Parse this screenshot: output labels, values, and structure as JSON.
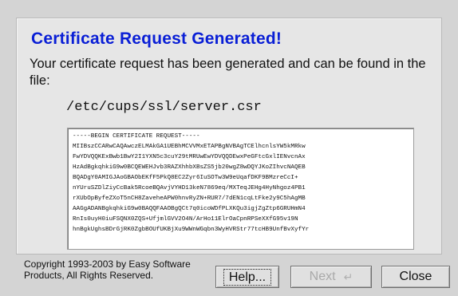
{
  "dialog": {
    "title": "Certificate Request Generated!",
    "message": "Your certificate request has been generated and can be found in the file:",
    "file_path": "/etc/cups/ssl/server.csr",
    "csr_text": "-----BEGIN CERTIFICATE REQUEST-----\nMIIBszCCARwCAQAwczELMAkGA1UEBhMCVVMxETAPBgNVBAgTCElhcnlsYW5kMRkw\nFwYDVQQKExBwb1BwY2I1YXN5c3cuY29tMRUwEwYDVQQDEwxPeGFtcGxlIENvcnAx\nHzAdBgkqhkiG9w0BCQEWEHJvb3RAZXhhbXBsZS5jb20wgZ8wDQYJKoZIhvcNAQEB\nBQADgY0AMIGJAoGBAObEKfF5PkQ8EC2Zyr6IuSOTw3W9eUqafDKF9BMzreCcI+\nnYUruSZDlZiyCcBak5RcoeBQAvjVYHD13keN7869eq/MXTeqJEHg4HyNhgoz4PB1\nrXUbOpByfeZXoT5nCH8ZaveheAPW0hnvRyZN+RUR7/7dEN1cqLtFke2y9C5hAgMB\nAAGgADANBgkqhkiG9w0BAQQFAAOBgQCt7q0icoWDfPLXKQu3igjZgZtp6GRUHmN4\nRnIs0uyH0iuFSQNX0ZQS+UfjmlGVV2O4N/ArHo11ElrOaCpnRPSeXXfG95v19N\nhnBgkUghsBDrGjRK0ZgbBOUfUKBjXu9WWnWGqbn3WyHVRStr77tcHB9UnfBvXyfYr"
  },
  "footer": {
    "copyright": "Copyright 1993-2003 by Easy Software Products, All Rights Reserved."
  },
  "buttons": {
    "help_label": "Help...",
    "next_label": "Next",
    "next_enabled": false,
    "close_label": "Close"
  },
  "icons": {
    "next_arrow": "return-arrow-icon"
  },
  "colors": {
    "title": "#0a1fd6",
    "background": "#d4d4d4",
    "panel": "#e6e6e6",
    "disabled_text": "#a9a9a9"
  }
}
